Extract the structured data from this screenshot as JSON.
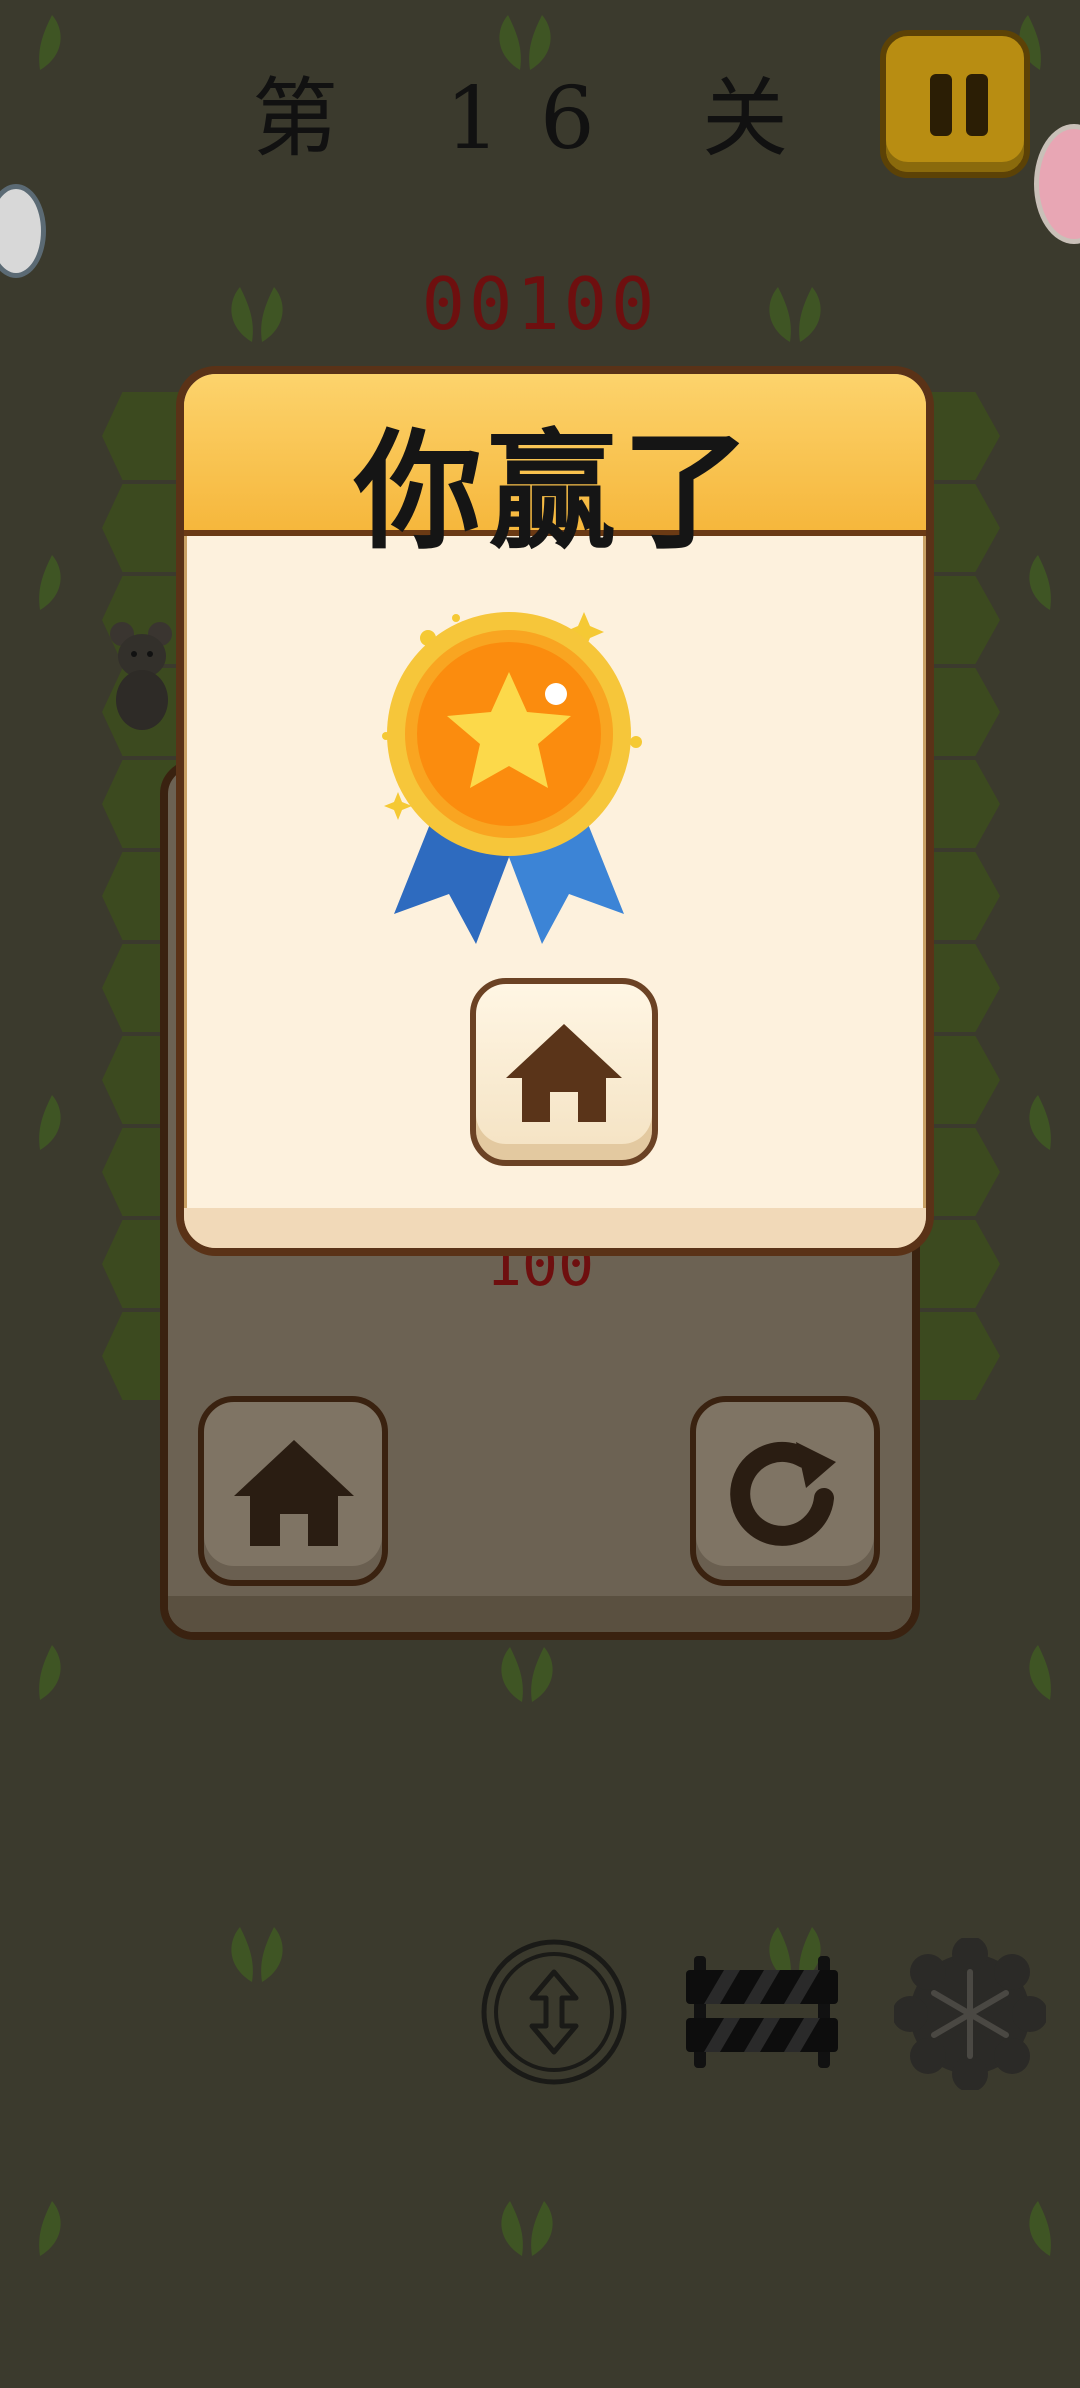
{
  "header": {
    "level_label": "第 16 关",
    "score": "00100"
  },
  "win_dialog": {
    "title": "你赢了",
    "medal_icon": "medal-star-icon",
    "home_icon": "home-icon"
  },
  "result_panel": {
    "score": "100",
    "home_icon": "home-icon",
    "restart_icon": "restart-icon"
  },
  "toolbar": {
    "items": [
      "swap-arrows-icon",
      "barrier-icon",
      "snowflake-icon"
    ]
  },
  "colors": {
    "background": "#3b3a2d",
    "modal_header": "#f6b73c",
    "modal_body": "#fdf1dd",
    "modal_border": "#5a3217",
    "score_red": "#6e0f0f"
  }
}
